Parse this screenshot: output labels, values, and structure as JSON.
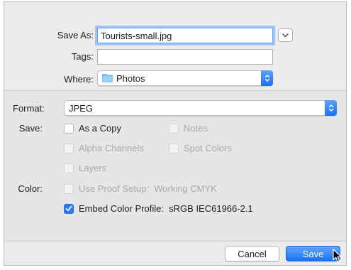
{
  "save_as": {
    "label": "Save As:",
    "value": "Tourists-small.jpg",
    "expand_icon": "chevron-down-icon"
  },
  "tags": {
    "label": "Tags:",
    "value": ""
  },
  "where": {
    "label": "Where:",
    "value": "Photos",
    "icon": "folder-icon"
  },
  "format": {
    "label": "Format:",
    "value": "JPEG"
  },
  "save_options": {
    "label": "Save:",
    "as_a_copy": {
      "label": "As a Copy",
      "checked": false,
      "enabled": true
    },
    "notes": {
      "label": "Notes",
      "checked": false,
      "enabled": false
    },
    "alpha_channels": {
      "label": "Alpha Channels",
      "checked": false,
      "enabled": false
    },
    "spot_colors": {
      "label": "Spot Colors",
      "checked": false,
      "enabled": false
    },
    "layers": {
      "label": "Layers",
      "checked": false,
      "enabled": false
    }
  },
  "color": {
    "label": "Color:",
    "use_proof_setup": {
      "label": "Use Proof Setup:  Working CMYK",
      "checked": false,
      "enabled": false
    },
    "embed_color_profile": {
      "label": "Embed Color Profile:  sRGB IEC61966-2.1",
      "checked": true,
      "enabled": true
    }
  },
  "footer": {
    "cancel_label": "Cancel",
    "save_label": "Save"
  },
  "colors": {
    "accent": "#1a70f5",
    "dialog_bg": "#ececec",
    "options_bg": "#e6e6e6"
  }
}
